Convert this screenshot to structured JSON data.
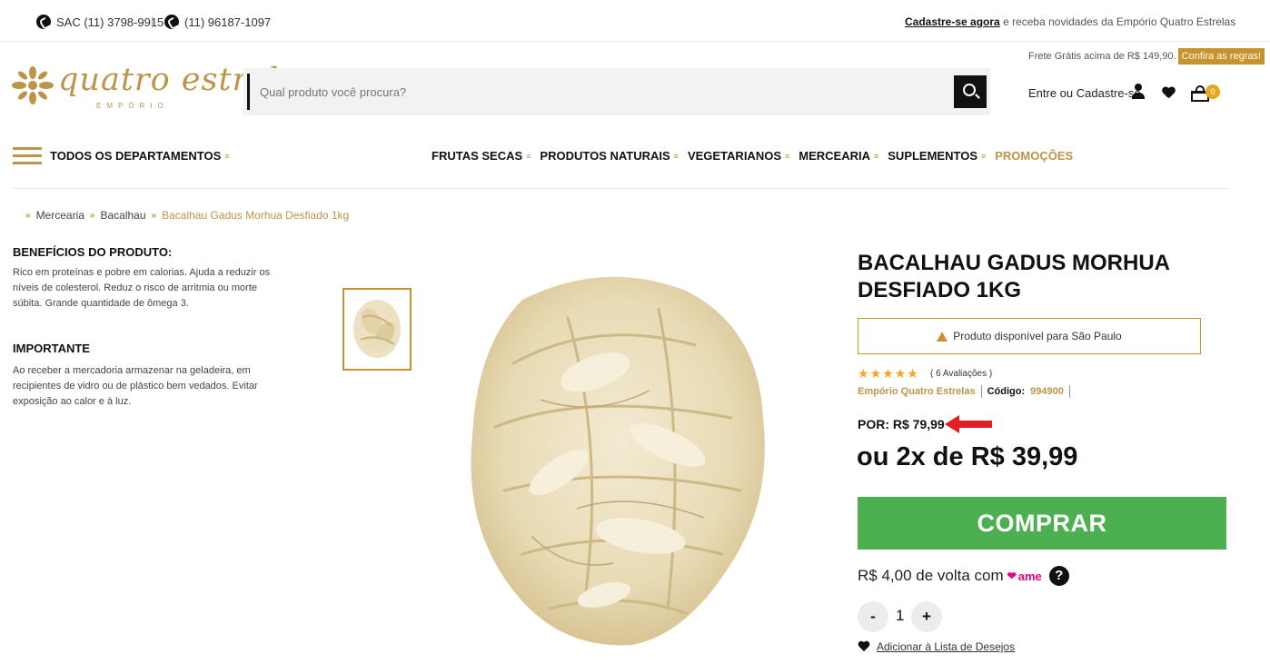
{
  "topbar": {
    "sac": "SAC (11) 3798-9915",
    "separator": "|",
    "whatsapp": "(11) 96187-1097",
    "signup_link": "Cadastre-se agora",
    "signup_text": "e receba novidades da Empório Quatro Estrelas"
  },
  "frete": {
    "text": "Frete Grátis acima de R$ 149,90.",
    "rules": "Confira as regras!"
  },
  "logo": {
    "name": "quatro estrelas",
    "sub": "EMPÓRIO"
  },
  "search": {
    "placeholder": "Qual produto você procura?"
  },
  "account": {
    "label": "Entre ou Cadastre-se",
    "cart_count": "0"
  },
  "nav": {
    "all_departments": "TODOS OS DEPARTAMENTOS",
    "items": [
      "FRUTAS SECAS",
      "PRODUTOS NATURAIS",
      "VEGETARIANOS",
      "MERCEARIA",
      "SUPLEMENTOS"
    ],
    "promo": "PROMOÇÕES"
  },
  "breadcrumb": {
    "items": [
      "Mercearia",
      "Bacalhau"
    ],
    "current": "Bacalhau Gadus Morhua Desfiado 1kg"
  },
  "info": {
    "benefits_title": "BENEFÍCIOS DO PRODUTO:",
    "benefits_text": "Rico em proteínas e pobre em calorias. Ajuda a reduzir os níveis de colesterol. Reduz o risco de arritmia ou morte súbita. Grande quantidade de ômega 3.",
    "important_title": "IMPORTANTE",
    "important_text": "Ao receber a mercadoria armazenar na geladeira, em recipientes de vidro ou de plástico bem vedados. Evitar exposição ao calor e à luz."
  },
  "product": {
    "title": "BACALHAU GADUS MORHUA DESFIADO 1KG",
    "availability": "Produto disponível para São Paulo",
    "rating_stars": 5,
    "reviews": "( 6 Avaliações )",
    "brand": "Empório Quatro Estrelas",
    "code_label": "Código:",
    "code": "994900",
    "price": "POR: R$ 79,99",
    "installments": "ou 2x de R$ 39,99",
    "buy_label": "COMPRAR",
    "cashback": "R$ 4,00 de volta com",
    "ame": "ame",
    "help": "?",
    "qty_minus": "-",
    "quantity": "1",
    "qty_plus": "+",
    "wishlist": "Adicionar à Lista de Desejos"
  },
  "colors": {
    "gold": "#bd9548",
    "buy_green": "#4caf50",
    "arrow_red": "#e31e24",
    "ame_pink": "#e5007e"
  }
}
